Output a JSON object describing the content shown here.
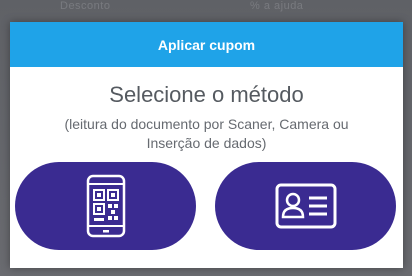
{
  "background": {
    "left_text": "Desconto",
    "right_text": "% a ajuda"
  },
  "dialog": {
    "title": "Aplicar cupom",
    "heading": "Selecione o método",
    "subtitle_line1": "(leitura do documento por Scaner, Camera ou",
    "subtitle_line2": "Inserção de dados)",
    "buttons": [
      {
        "name": "scanner-camera",
        "icon": "phone-qr-icon"
      },
      {
        "name": "manual-data",
        "icon": "id-card-icon"
      }
    ]
  },
  "colors": {
    "header": "#1fa3e8",
    "button": "#3a2b91",
    "icon": "#ffffff"
  }
}
